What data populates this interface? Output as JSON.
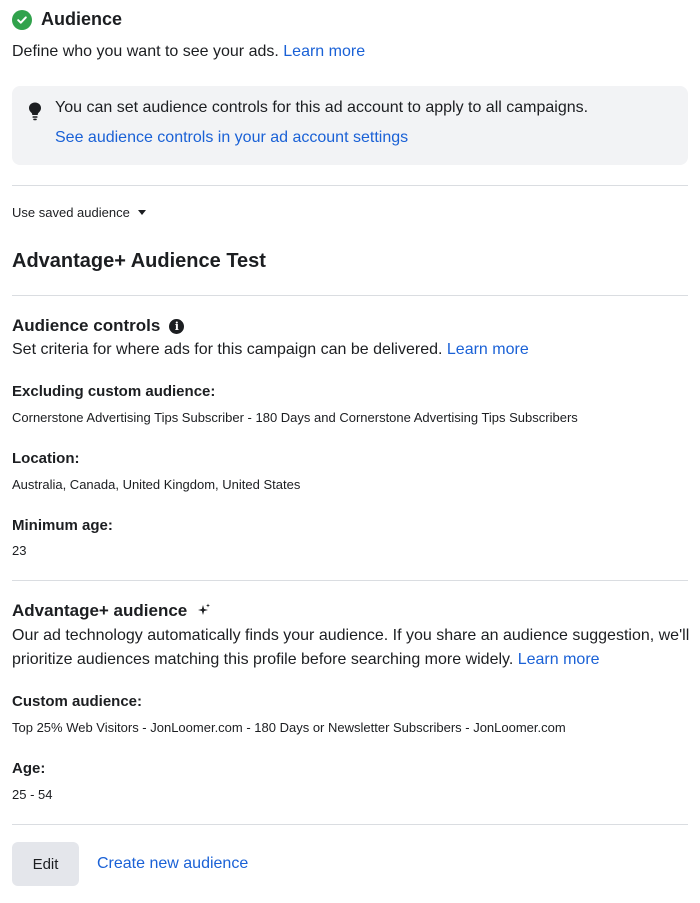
{
  "section": {
    "title": "Audience",
    "intro": "Define who you want to see your ads.",
    "intro_link": "Learn more"
  },
  "info_box": {
    "text": "You can set audience controls for this ad account to apply to all campaigns.",
    "link": "See audience controls in your ad account settings"
  },
  "saved_audience": {
    "label": "Use saved audience",
    "name": "Advantage+ Audience Test"
  },
  "audience_controls": {
    "title": "Audience controls",
    "description": "Set criteria for where ads for this campaign can be delivered.",
    "link": "Learn more",
    "excluding_label": "Excluding custom audience:",
    "excluding_value": "Cornerstone Advertising Tips Subscriber - 180 Days and Cornerstone Advertising Tips Subscribers",
    "location_label": "Location:",
    "location_value": "Australia, Canada, United Kingdom, United States",
    "min_age_label": "Minimum age:",
    "min_age_value": "23"
  },
  "advantage_audience": {
    "title": "Advantage+ audience",
    "description": "Our ad technology automatically finds your audience. If you share an audience suggestion, we'll prioritize audiences matching this profile before searching more widely.",
    "link": "Learn more",
    "custom_label": "Custom audience:",
    "custom_value": "Top 25% Web Visitors - JonLoomer.com - 180 Days or Newsletter Subscribers - JonLoomer.com",
    "age_label": "Age:",
    "age_value": "25 - 54"
  },
  "actions": {
    "edit": "Edit",
    "create": "Create new audience"
  },
  "colors": {
    "link": "#1a61d6",
    "success": "#31a24c",
    "info_bg": "#f2f3f5",
    "divider": "#dadde1",
    "button_bg": "#e4e6eb"
  },
  "icons": {
    "header": "check-circle-icon",
    "info_box": "lightbulb-icon",
    "dropdown": "caret-down-icon",
    "controls": "info-icon",
    "advantage": "sparkle-icon"
  }
}
